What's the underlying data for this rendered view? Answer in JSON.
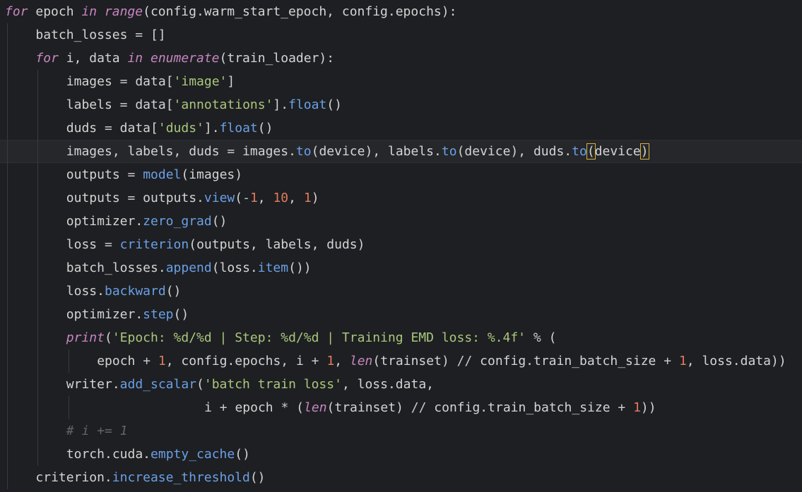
{
  "editor": {
    "language": "python",
    "colors": {
      "background": "#1e1f22",
      "current_line": "#26272b",
      "keyword": "#c586c0",
      "function": "#6aa0e6",
      "string": "#a9c77d",
      "number": "#e07a5f",
      "comment": "#62646c",
      "bracket_match": "#d8b33a"
    },
    "current_line_index": 6,
    "lines": [
      {
        "indent": 0,
        "tokens": [
          {
            "t": "kw",
            "v": "for"
          },
          {
            "t": "tx",
            "v": " epoch "
          },
          {
            "t": "kw",
            "v": "in"
          },
          {
            "t": "tx",
            "v": " "
          },
          {
            "t": "bi",
            "v": "range"
          },
          {
            "t": "pn",
            "v": "("
          },
          {
            "t": "tx",
            "v": "config.warm_start_epoch, config.epochs"
          },
          {
            "t": "pn",
            "v": "):"
          }
        ]
      },
      {
        "indent": 1,
        "tokens": [
          {
            "t": "tx",
            "v": "batch_losses "
          },
          {
            "t": "op",
            "v": "="
          },
          {
            "t": "tx",
            "v": " "
          },
          {
            "t": "pn",
            "v": "[]"
          }
        ]
      },
      {
        "indent": 1,
        "tokens": [
          {
            "t": "kw",
            "v": "for"
          },
          {
            "t": "tx",
            "v": " i, data "
          },
          {
            "t": "kw",
            "v": "in"
          },
          {
            "t": "tx",
            "v": " "
          },
          {
            "t": "bi",
            "v": "enumerate"
          },
          {
            "t": "pn",
            "v": "("
          },
          {
            "t": "tx",
            "v": "train_loader"
          },
          {
            "t": "pn",
            "v": "):"
          }
        ]
      },
      {
        "indent": 2,
        "tokens": [
          {
            "t": "tx",
            "v": "images "
          },
          {
            "t": "op",
            "v": "="
          },
          {
            "t": "tx",
            "v": " data"
          },
          {
            "t": "pn",
            "v": "["
          },
          {
            "t": "str",
            "v": "'image'"
          },
          {
            "t": "pn",
            "v": "]"
          }
        ]
      },
      {
        "indent": 2,
        "tokens": [
          {
            "t": "tx",
            "v": "labels "
          },
          {
            "t": "op",
            "v": "="
          },
          {
            "t": "tx",
            "v": " data"
          },
          {
            "t": "pn",
            "v": "["
          },
          {
            "t": "str",
            "v": "'annotations'"
          },
          {
            "t": "pn",
            "v": "]."
          },
          {
            "t": "fn",
            "v": "float"
          },
          {
            "t": "pn",
            "v": "()"
          }
        ]
      },
      {
        "indent": 2,
        "tokens": [
          {
            "t": "tx",
            "v": "duds "
          },
          {
            "t": "op",
            "v": "="
          },
          {
            "t": "tx",
            "v": " data"
          },
          {
            "t": "pn",
            "v": "["
          },
          {
            "t": "str",
            "v": "'duds'"
          },
          {
            "t": "pn",
            "v": "]."
          },
          {
            "t": "fn",
            "v": "float"
          },
          {
            "t": "pn",
            "v": "()"
          }
        ]
      },
      {
        "indent": 2,
        "tokens": [
          {
            "t": "tx",
            "v": "images, labels, duds "
          },
          {
            "t": "op",
            "v": "="
          },
          {
            "t": "tx",
            "v": " images."
          },
          {
            "t": "fn",
            "v": "to"
          },
          {
            "t": "pn",
            "v": "("
          },
          {
            "t": "tx",
            "v": "device"
          },
          {
            "t": "pn",
            "v": ")"
          },
          {
            "t": "tx",
            "v": ", labels."
          },
          {
            "t": "fn",
            "v": "to"
          },
          {
            "t": "pn",
            "v": "("
          },
          {
            "t": "tx",
            "v": "device"
          },
          {
            "t": "pn",
            "v": ")"
          },
          {
            "t": "tx",
            "v": ", duds."
          },
          {
            "t": "fn",
            "v": "to"
          },
          {
            "t": "bm",
            "v": "("
          },
          {
            "t": "tx",
            "v": "device"
          },
          {
            "t": "bm",
            "v": ")"
          }
        ]
      },
      {
        "indent": 2,
        "tokens": [
          {
            "t": "tx",
            "v": "outputs "
          },
          {
            "t": "op",
            "v": "="
          },
          {
            "t": "tx",
            "v": " "
          },
          {
            "t": "fn",
            "v": "model"
          },
          {
            "t": "pn",
            "v": "("
          },
          {
            "t": "tx",
            "v": "images"
          },
          {
            "t": "pn",
            "v": ")"
          }
        ]
      },
      {
        "indent": 2,
        "tokens": [
          {
            "t": "tx",
            "v": "outputs "
          },
          {
            "t": "op",
            "v": "="
          },
          {
            "t": "tx",
            "v": " outputs."
          },
          {
            "t": "fn",
            "v": "view"
          },
          {
            "t": "pn",
            "v": "("
          },
          {
            "t": "op",
            "v": "-"
          },
          {
            "t": "num",
            "v": "1"
          },
          {
            "t": "tx",
            "v": ", "
          },
          {
            "t": "num",
            "v": "10"
          },
          {
            "t": "tx",
            "v": ", "
          },
          {
            "t": "num",
            "v": "1"
          },
          {
            "t": "pn",
            "v": ")"
          }
        ]
      },
      {
        "indent": 2,
        "tokens": [
          {
            "t": "tx",
            "v": "optimizer."
          },
          {
            "t": "fn",
            "v": "zero_grad"
          },
          {
            "t": "pn",
            "v": "()"
          }
        ]
      },
      {
        "indent": 2,
        "tokens": [
          {
            "t": "tx",
            "v": "loss "
          },
          {
            "t": "op",
            "v": "="
          },
          {
            "t": "tx",
            "v": " "
          },
          {
            "t": "fn",
            "v": "criterion"
          },
          {
            "t": "pn",
            "v": "("
          },
          {
            "t": "tx",
            "v": "outputs, labels, duds"
          },
          {
            "t": "pn",
            "v": ")"
          }
        ]
      },
      {
        "indent": 2,
        "tokens": [
          {
            "t": "tx",
            "v": "batch_losses."
          },
          {
            "t": "fn",
            "v": "append"
          },
          {
            "t": "pn",
            "v": "("
          },
          {
            "t": "tx",
            "v": "loss."
          },
          {
            "t": "fn",
            "v": "item"
          },
          {
            "t": "pn",
            "v": "())"
          }
        ]
      },
      {
        "indent": 2,
        "tokens": [
          {
            "t": "tx",
            "v": "loss."
          },
          {
            "t": "fn",
            "v": "backward"
          },
          {
            "t": "pn",
            "v": "()"
          }
        ]
      },
      {
        "indent": 2,
        "tokens": [
          {
            "t": "tx",
            "v": "optimizer."
          },
          {
            "t": "fn",
            "v": "step"
          },
          {
            "t": "pn",
            "v": "()"
          }
        ]
      },
      {
        "indent": 2,
        "tokens": [
          {
            "t": "bi",
            "v": "print"
          },
          {
            "t": "pn",
            "v": "("
          },
          {
            "t": "str",
            "v": "'Epoch: %d/%d | Step: %d/%d | Training EMD loss: %.4f'"
          },
          {
            "t": "tx",
            "v": " "
          },
          {
            "t": "op",
            "v": "%"
          },
          {
            "t": "tx",
            "v": " "
          },
          {
            "t": "pn",
            "v": "("
          }
        ]
      },
      {
        "indent": 3,
        "tokens": [
          {
            "t": "tx",
            "v": "epoch "
          },
          {
            "t": "op",
            "v": "+"
          },
          {
            "t": "tx",
            "v": " "
          },
          {
            "t": "num",
            "v": "1"
          },
          {
            "t": "tx",
            "v": ", config.epochs, i "
          },
          {
            "t": "op",
            "v": "+"
          },
          {
            "t": "tx",
            "v": " "
          },
          {
            "t": "num",
            "v": "1"
          },
          {
            "t": "tx",
            "v": ", "
          },
          {
            "t": "bi",
            "v": "len"
          },
          {
            "t": "pn",
            "v": "("
          },
          {
            "t": "tx",
            "v": "trainset"
          },
          {
            "t": "pn",
            "v": ")"
          },
          {
            "t": "tx",
            "v": " "
          },
          {
            "t": "op",
            "v": "//"
          },
          {
            "t": "tx",
            "v": " config.train_batch_size "
          },
          {
            "t": "op",
            "v": "+"
          },
          {
            "t": "tx",
            "v": " "
          },
          {
            "t": "num",
            "v": "1"
          },
          {
            "t": "tx",
            "v": ", loss.data"
          },
          {
            "t": "pn",
            "v": "))"
          }
        ]
      },
      {
        "indent": 2,
        "tokens": [
          {
            "t": "tx",
            "v": "writer."
          },
          {
            "t": "fn",
            "v": "add_scalar"
          },
          {
            "t": "pn",
            "v": "("
          },
          {
            "t": "str",
            "v": "'batch train loss'"
          },
          {
            "t": "tx",
            "v": ", loss.data,"
          }
        ]
      },
      {
        "indent": 2,
        "extra_spaces": 18,
        "tokens": [
          {
            "t": "tx",
            "v": "i "
          },
          {
            "t": "op",
            "v": "+"
          },
          {
            "t": "tx",
            "v": " epoch "
          },
          {
            "t": "op",
            "v": "*"
          },
          {
            "t": "tx",
            "v": " "
          },
          {
            "t": "pn",
            "v": "("
          },
          {
            "t": "bi",
            "v": "len"
          },
          {
            "t": "pn",
            "v": "("
          },
          {
            "t": "tx",
            "v": "trainset"
          },
          {
            "t": "pn",
            "v": ")"
          },
          {
            "t": "tx",
            "v": " "
          },
          {
            "t": "op",
            "v": "//"
          },
          {
            "t": "tx",
            "v": " config.train_batch_size "
          },
          {
            "t": "op",
            "v": "+"
          },
          {
            "t": "tx",
            "v": " "
          },
          {
            "t": "num",
            "v": "1"
          },
          {
            "t": "pn",
            "v": "))"
          }
        ]
      },
      {
        "indent": 2,
        "tokens": [
          {
            "t": "cmt",
            "v": "# i += 1"
          }
        ]
      },
      {
        "indent": 2,
        "tokens": [
          {
            "t": "tx",
            "v": "torch.cuda."
          },
          {
            "t": "fn",
            "v": "empty_cache"
          },
          {
            "t": "pn",
            "v": "()"
          }
        ]
      },
      {
        "indent": 1,
        "tokens": [
          {
            "t": "tx",
            "v": "criterion."
          },
          {
            "t": "fn",
            "v": "increase_threshold"
          },
          {
            "t": "pn",
            "v": "()"
          }
        ]
      }
    ]
  }
}
